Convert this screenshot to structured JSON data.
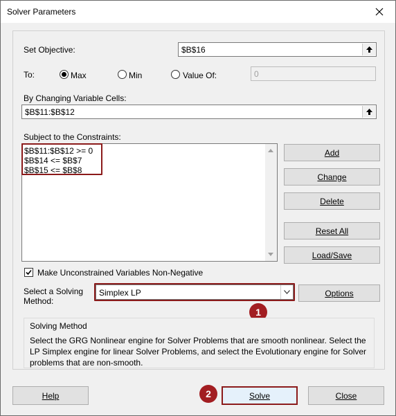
{
  "window": {
    "title": "Solver Parameters"
  },
  "objective": {
    "label": "Set Objective:",
    "value": "$B$16"
  },
  "to": {
    "label": "To:",
    "options": [
      {
        "label": "Max",
        "selected": true
      },
      {
        "label": "Min",
        "selected": false
      },
      {
        "label": "Value Of:",
        "selected": false
      }
    ],
    "value_of": "0"
  },
  "changing": {
    "label": "By Changing Variable Cells:",
    "value": "$B$11:$B$12"
  },
  "constraints": {
    "label": "Subject to the Constraints:",
    "items": [
      "$B$11:$B$12 >= 0",
      "$B$14 <= $B$7",
      "$B$15 <= $B$8"
    ]
  },
  "buttons": {
    "add": "Add",
    "change": "Change",
    "delete": "Delete",
    "reset_all": "Reset All",
    "load_save": "Load/Save",
    "options": "Options",
    "help": "Help",
    "solve": "Solve",
    "close": "Close"
  },
  "nonneg": {
    "label": "Make Unconstrained Variables Non-Negative",
    "checked": true
  },
  "method": {
    "label_line1": "Select a Solving",
    "label_line2": "Method:",
    "value": "Simplex LP"
  },
  "solving_method": {
    "title": "Solving Method",
    "text": "Select the GRG Nonlinear engine for Solver Problems that are smooth nonlinear. Select the LP Simplex engine for linear Solver Problems, and select the Evolutionary engine for Solver problems that are non-smooth."
  },
  "annotations": {
    "badge1": "1",
    "badge2": "2"
  },
  "colors": {
    "highlight": "#8b1a1a",
    "badge": "#a21d21"
  }
}
